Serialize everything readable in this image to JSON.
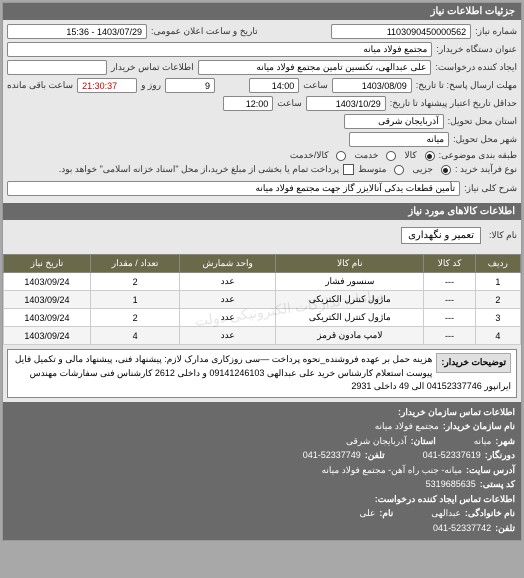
{
  "panel_title": "جزئیات اطلاعات نیاز",
  "request_number_label": "شماره نیاز:",
  "request_number": "1103090450000562",
  "public_announce_label": "تاریخ و ساعت اعلان عمومی:",
  "public_announce": "1403/07/29 - 15:36",
  "buyer_apparatus_label": "عنوان دستگاه خریدار:",
  "buyer_apparatus": "مجتمع فولاد میانه",
  "requester_label": "ایجاد کننده درخواست:",
  "requester": "علی عبدالهی، تکنسین تامین مجتمع فولاد میانه",
  "buyer_contact_label": "اطلاعات تماس خریدار",
  "buyer_contact": "",
  "deadline_start_label": "مهلت ارسال پاسخ: تا تاریخ:",
  "deadline_date": "1403/08/09",
  "time_label": "ساعت",
  "deadline_time": "14:00",
  "days_label": "روز و",
  "remaining_days": "9",
  "remaining_time": "21:30:37",
  "remaining_label": "ساعت باقی مانده",
  "validity_label": "حداقل تاریخ اعتبار پیشنهاد تا تاریخ:",
  "validity_date": "1403/10/29",
  "validity_time": "12:00",
  "delivery_province_label": "استان محل تحویل:",
  "delivery_province": "آذربایجان شرقی",
  "delivery_city_label": "شهر محل تحویل:",
  "delivery_city": "میانه",
  "budget_class_label": "طبقه بندی موضوعی:",
  "radio_goods": "کالا",
  "radio_service": "کالا/خدمت",
  "radio_service2": "خدمت",
  "buy_type_label": "نوع فرآیند خرید :",
  "radio_low": "جزیی",
  "radio_mid": "متوسط",
  "mid_note": "پرداخت تمام یا بخشی از مبلغ خرید،از محل \"اسناد خزانه اسلامی\" خواهد بود.",
  "need_summary_label": "شرح کلی نیاز:",
  "need_summary": "تأمین قطعات یدکی آنالایزر گاز جهت مجتمع فولاد میانه",
  "subheader_goods": "اطلاعات کالاهای مورد نیاز",
  "goods_name_label": "نام کالا:",
  "goods_name": "تعمیر و نگهداری",
  "table": {
    "headers": [
      "ردیف",
      "کد کالا",
      "نام کالا",
      "واحد شمارش",
      "تعداد / مقدار",
      "تاریخ نیاز"
    ],
    "rows": [
      [
        "1",
        "---",
        "سنسور فشار",
        "عدد",
        "2",
        "1403/09/24"
      ],
      [
        "2",
        "---",
        "ماژول کنترل الکتریکی",
        "عدد",
        "1",
        "1403/09/24"
      ],
      [
        "3",
        "---",
        "ماژول کنترل الکتریکی",
        "عدد",
        "2",
        "1403/09/24"
      ],
      [
        "4",
        "---",
        "لامپ مادون قرمز",
        "عدد",
        "4",
        "1403/09/24"
      ]
    ]
  },
  "notes_label": "توضیحات خریدار:",
  "notes_text": "هزینه حمل بر عهده فروشنده_نحوه پرداخت —سی روزکاری مدارک لازم: پیشنهاد فنی، پیشنهاد مالی و تکمیل فایل پیوست استعلام کارشناس خرید علی عبدالهی 09141246103 و داخلی 2612 کارشناس فنی سفارشات مهندس ایرانپور 04152337746 الی 49 داخلی 2931",
  "footer_header": "اطلاعات تماس سازمان خریدار:",
  "footer": {
    "org_label": "نام سازمان خریدار:",
    "org": "مجتمع فولاد میانه",
    "city_label": "شهر:",
    "city": "میانه",
    "province_label": "استان:",
    "province": "آذربایجان شرقی",
    "fax_label": "دورنگار:",
    "fax": "041-52337619",
    "tel_label": "تلفن:",
    "tel": "041-52337749",
    "address_label": "آدرس سایت:",
    "address": "میانه- جنب راه آهن- مجتمع فولاد میانه",
    "postcode_label": "کد پستی:",
    "postcode": "5319685635",
    "creator_contact_label": "اطلاعات تماس ایجاد کننده درخواست:",
    "last_name_label": "نام خانوادگی:",
    "last_name": "عبدالهی",
    "first_name_label": "نام:",
    "first_name": "علی",
    "phone_label": "تلفن:",
    "phone": "041-52337742"
  },
  "watermark": "سامانه تدارکات الکترونیکی دولت"
}
